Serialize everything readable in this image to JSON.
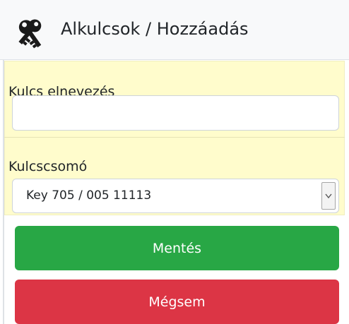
{
  "header": {
    "title": "Alkulcsok / Hozzáadás",
    "icon": "keys-icon"
  },
  "form": {
    "key_name_label": "Kulcs elnevezés",
    "key_name_value": "",
    "keyring_label": "Kulcscsomó",
    "keyring_selected": "Key 705 / 005 11113"
  },
  "actions": {
    "save_label": "Mentés",
    "cancel_label": "Mégsem"
  },
  "colors": {
    "save": "#28a745",
    "cancel": "#dc3545",
    "panel": "#fffccc"
  }
}
